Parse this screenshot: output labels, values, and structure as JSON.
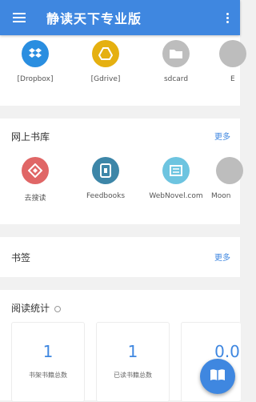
{
  "appbar": {
    "title": "静读天下专业版"
  },
  "storage": {
    "items": [
      {
        "label": "[Dropbox]",
        "color": "#2a8ee0",
        "icon": "dropbox-icon"
      },
      {
        "label": "[Gdrive]",
        "color": "#e5b010",
        "icon": "gdrive-icon"
      },
      {
        "label": "sdcard",
        "color": "#bdbdbd",
        "icon": "folder-icon"
      },
      {
        "label": "E",
        "color": "#bdbdbd",
        "icon": "folder-icon"
      }
    ]
  },
  "online_library": {
    "title": "网上书库",
    "more": "更多",
    "items": [
      {
        "label": "去搜读",
        "color": "#e06666",
        "icon": "diamond-icon",
        "glyph": "◈"
      },
      {
        "label": "Feedbooks",
        "color": "#3d86a8",
        "icon": "feedbooks-icon",
        "glyph": "▣"
      },
      {
        "label": "WebNovel.com",
        "color": "#6dc4e0",
        "icon": "webnovel-icon",
        "glyph": "▦"
      },
      {
        "label": "Moon",
        "color": "#bdbdbd",
        "icon": "moon-icon",
        "glyph": ""
      }
    ]
  },
  "bookmarks": {
    "title": "书签",
    "more": "更多"
  },
  "stats": {
    "title": "阅读统计",
    "boxes": [
      {
        "value": "1",
        "label": "书架书籍总数"
      },
      {
        "value": "1",
        "label": "已读书籍总数"
      },
      {
        "value": "0.0",
        "label": ""
      }
    ]
  },
  "fab": {
    "icon": "book-icon"
  }
}
